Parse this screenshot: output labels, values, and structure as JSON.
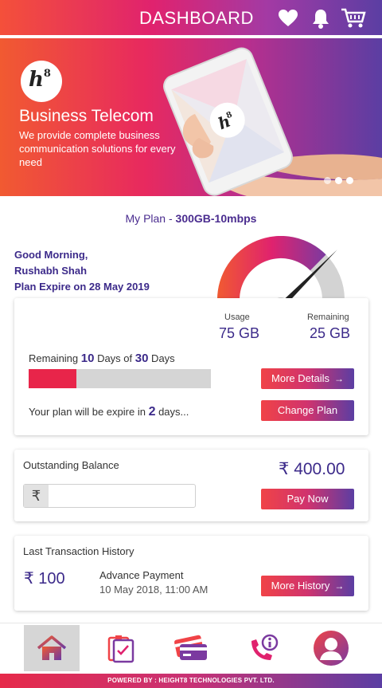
{
  "header": {
    "title": "DASHBOARD",
    "icons": [
      "heart-icon",
      "bell-icon",
      "cart-icon"
    ]
  },
  "banner": {
    "logo_text": "h",
    "logo_sup": "8",
    "title": "Business Telecom",
    "text": "We provide complete business communication solutions for every need",
    "slides": 3,
    "active_slide": 3
  },
  "plan": {
    "prefix": "My Plan - ",
    "name": "300GB-10mbps"
  },
  "greeting": {
    "line1": "Good Morning,",
    "line2": "Rushabh Shah",
    "line3": "Plan Expire on 28 May 2019"
  },
  "usage": {
    "usage_label": "Usage",
    "usage_value": "75 GB",
    "remaining_label": "Remaining",
    "remaining_value": "25 GB",
    "days_prefix": "Remaining ",
    "days_remaining": "10",
    "days_mid": " Days of ",
    "days_total": "30",
    "days_suffix": " Days",
    "progress_fraction": 0.26,
    "expire_prefix": "Your plan will be expire in ",
    "expire_days": "2",
    "expire_suffix": " days...",
    "more_details_label": "More Details",
    "change_plan_label": "Change Plan"
  },
  "balance": {
    "title": "Outstanding Balance",
    "amount": "₹ 400.00",
    "rupee_symbol": "₹",
    "input_value": "",
    "pay_label": "Pay Now"
  },
  "transactions": {
    "title": "Last Transaction History",
    "amount": "₹ 100",
    "name": "Advance Payment",
    "date": "10 May 2018,  11:00 AM",
    "more_label": "More History"
  },
  "nav": {
    "items": [
      "home-icon",
      "clipboard-icon",
      "cards-icon",
      "phone-info-icon",
      "profile-icon"
    ],
    "active": "home-icon"
  },
  "footer": {
    "text": "POWERED BY : HEIGHT8 TECHNOLOGIES PVT. LTD."
  },
  "colors": {
    "primary": "#3c2a8a",
    "accent": "#e8254a",
    "orange": "#f15a31",
    "purple": "#5b3ea3"
  }
}
